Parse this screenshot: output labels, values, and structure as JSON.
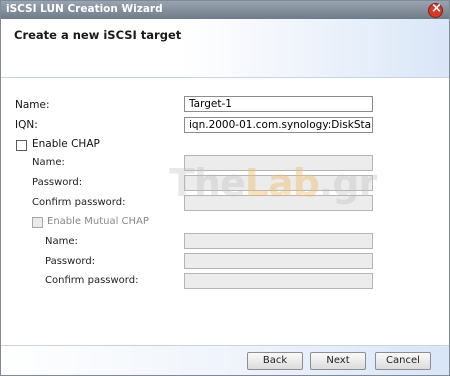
{
  "window": {
    "title": "iSCSI LUN Creation Wizard"
  },
  "header": {
    "title": "Create a new iSCSI target"
  },
  "form": {
    "name_label": "Name:",
    "name_value": "Target-1",
    "iqn_label": "IQN:",
    "iqn_value": "iqn.2000-01.com.synology:DiskSta",
    "chap": {
      "enable_label": "Enable CHAP",
      "name_label": "Name:",
      "password_label": "Password:",
      "confirm_label": "Confirm password:"
    },
    "mutual_chap": {
      "enable_label": "Enable Mutual CHAP",
      "name_label": "Name:",
      "password_label": "Password:",
      "confirm_label": "Confirm password:"
    }
  },
  "buttons": {
    "back": "Back",
    "next": "Next",
    "cancel": "Cancel"
  },
  "watermark": {
    "part1": "The",
    "part2": "Lab",
    "part3": ".gr"
  },
  "colors": {
    "titlebar": "#7f8a96",
    "close": "#d33a2a"
  }
}
